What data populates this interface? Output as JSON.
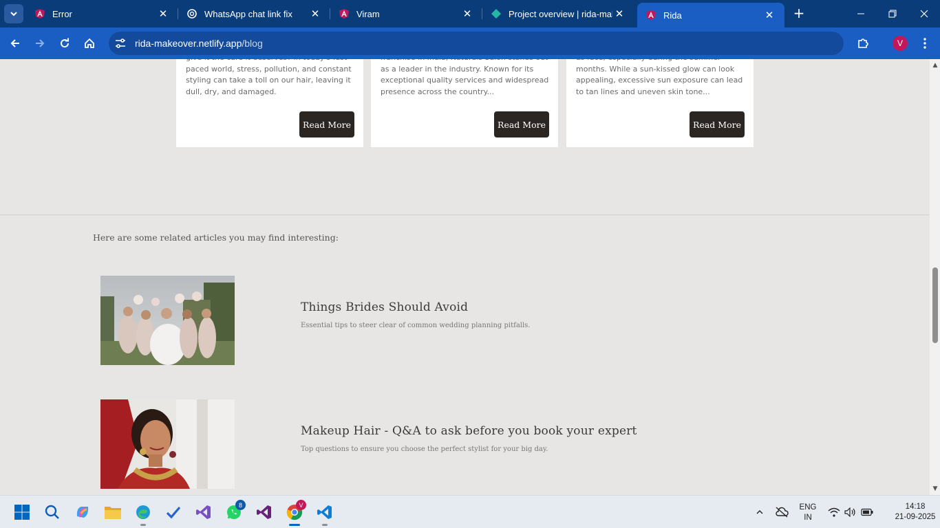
{
  "browser": {
    "tabs": [
      {
        "title": "Error",
        "active": false,
        "favicon": "angular-icon"
      },
      {
        "title": "WhatsApp chat link fix",
        "active": false,
        "favicon": "openai-icon"
      },
      {
        "title": "Viram",
        "active": false,
        "favicon": "angular-icon"
      },
      {
        "title": "Project overview | rida-make",
        "active": false,
        "favicon": "netlify-icon"
      },
      {
        "title": "Rida",
        "active": true,
        "favicon": "angular-icon"
      }
    ],
    "url_host": "rida-makeover.netlify.app",
    "url_path": "/blog",
    "profile_initial": "V"
  },
  "blog_cards": [
    {
      "excerpt": "give it the care it deserves? In today's fast paced world, stress, pollution, and constant styling can take a toll on our hair, leaving it dull, dry, and damaged.",
      "button": "Read More"
    },
    {
      "excerpt": "franchise in India, Naturals Salon stands out as a leader in the industry. Known for its exceptional quality services and widespread presence across the country...",
      "button": "Read More"
    },
    {
      "excerpt": "as face, especially during the summer months. While a sun-kissed glow can look appealing, excessive sun exposure can lead to tan lines and uneven skin tone...",
      "button": "Read More"
    }
  ],
  "related": {
    "intro": "Here are some related articles you may find interesting:",
    "articles": [
      {
        "title": "Things Brides Should Avoid",
        "description": "Essential tips to steer clear of common wedding planning pitfalls."
      },
      {
        "title": "Makeup Hair - Q&A to ask before you book your expert",
        "description": "Top questions to ensure you choose the perfect stylist for your big day."
      }
    ]
  },
  "taskbar": {
    "whatsapp_badge": "8",
    "chrome_badge": "V",
    "lang_line1": "ENG",
    "lang_line2": "IN",
    "time": "14:18",
    "date": "21-09-2025"
  },
  "colors": {
    "tabbar": "#0b3c7a",
    "toolbar": "#1a5ec4",
    "page_bg": "#e8e6e4",
    "button_dark": "#2c2622"
  }
}
